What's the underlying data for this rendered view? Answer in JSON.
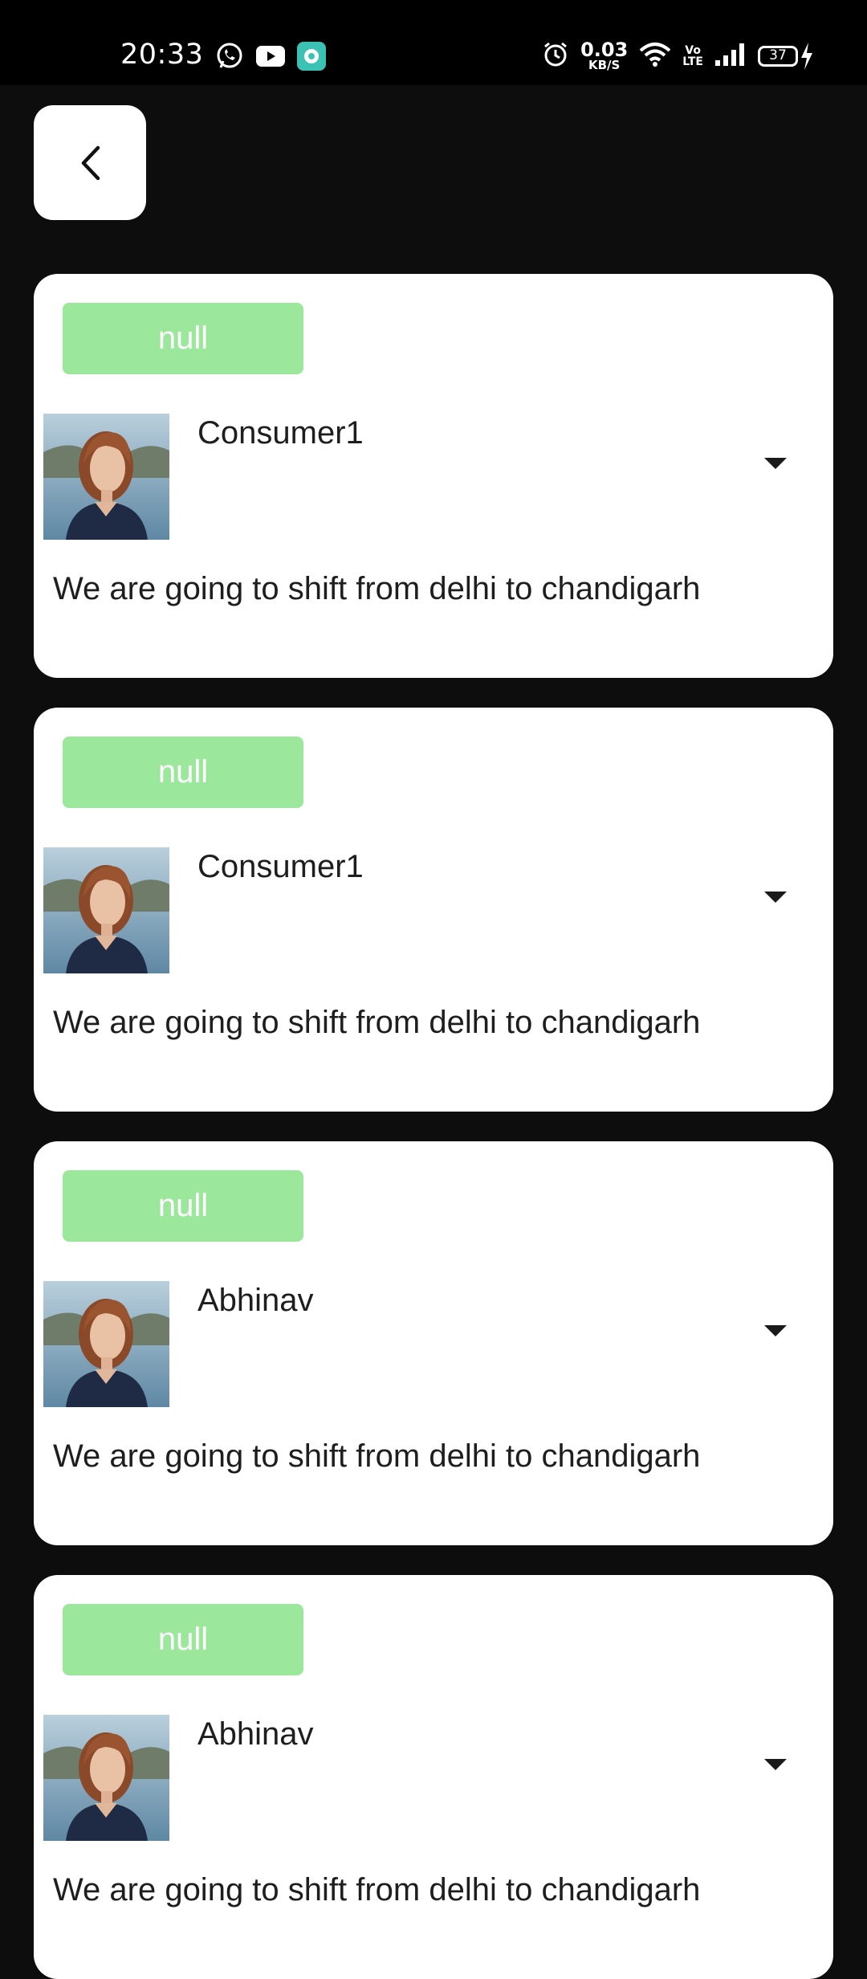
{
  "status_bar": {
    "time": "20:33",
    "net_speed_value": "0.03",
    "net_speed_unit": "KB/S",
    "volte_top": "Vo",
    "volte_bottom": "LTE",
    "battery": "37",
    "icons": [
      "whatsapp-icon",
      "youtube-icon",
      "chat-app-icon",
      "alarm-icon",
      "wifi-icon",
      "signal-icon",
      "battery-icon",
      "charging-bolt-icon"
    ]
  },
  "nav": {
    "back_icon": "chevron-left-icon"
  },
  "colors": {
    "background": "#0d0d0d",
    "card": "#ffffff",
    "badge": "#9be79b",
    "text": "#1e1e1e"
  },
  "posts": [
    {
      "badge": "null",
      "name": "Consumer1",
      "message": "We are going to shift from delhi to chandigarh"
    },
    {
      "badge": "null",
      "name": "Consumer1",
      "message": "We are going to shift from delhi to chandigarh"
    },
    {
      "badge": "null",
      "name": "Abhinav",
      "message": "We are going to shift from delhi to chandigarh"
    },
    {
      "badge": "null",
      "name": "Abhinav",
      "message": "We are going to shift from delhi to chandigarh"
    }
  ]
}
